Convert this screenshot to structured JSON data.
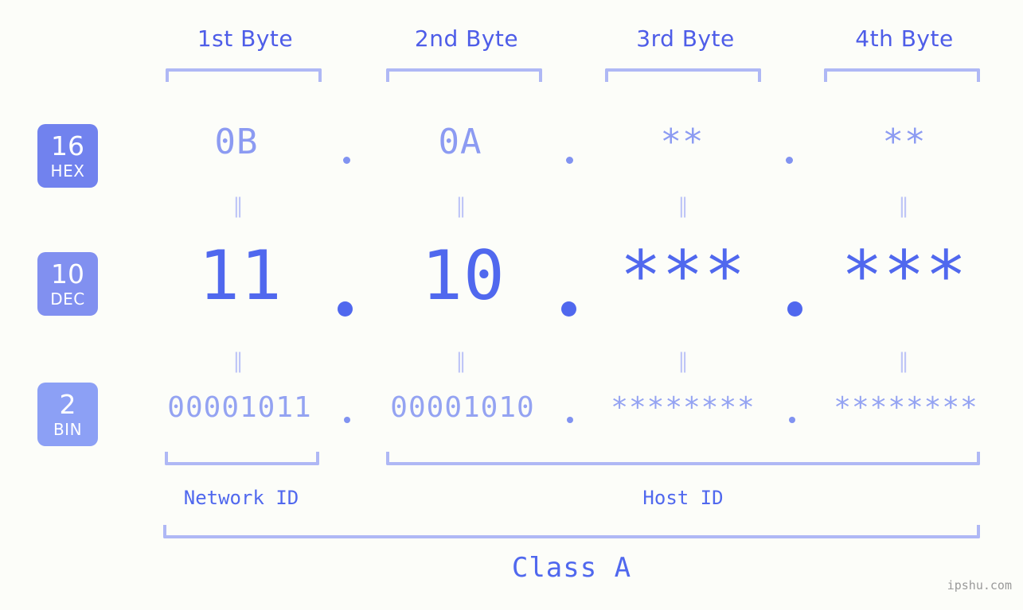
{
  "meta": {
    "background": "#FCFDF9",
    "accent_dark": "#5068EE",
    "accent_mid": "#7182EE",
    "accent_light": "#8CA0F5",
    "bracket_color": "#AFB8F5",
    "watermark": "ipshu.com"
  },
  "headers": [
    {
      "label": "1st Byte"
    },
    {
      "label": "2nd Byte"
    },
    {
      "label": "3rd Byte"
    },
    {
      "label": "4th Byte"
    }
  ],
  "bases": [
    {
      "num": "16",
      "abbr": "HEX",
      "color": "#7182EE"
    },
    {
      "num": "10",
      "abbr": "DEC",
      "color": "#8190F0"
    },
    {
      "num": "2",
      "abbr": "BIN",
      "color": "#8CA0F5"
    }
  ],
  "rows": {
    "hex": {
      "values": [
        "0B",
        "0A",
        "**",
        "**"
      ]
    },
    "dec": {
      "values": [
        "11",
        "10",
        "***",
        "***"
      ]
    },
    "bin": {
      "values": [
        "00001011",
        "00001010",
        "********",
        "********"
      ]
    }
  },
  "separators": {
    "equal_mark": "‖",
    "dot": "."
  },
  "sections": {
    "network_id": "Network ID",
    "host_id": "Host ID",
    "class": "Class A"
  }
}
